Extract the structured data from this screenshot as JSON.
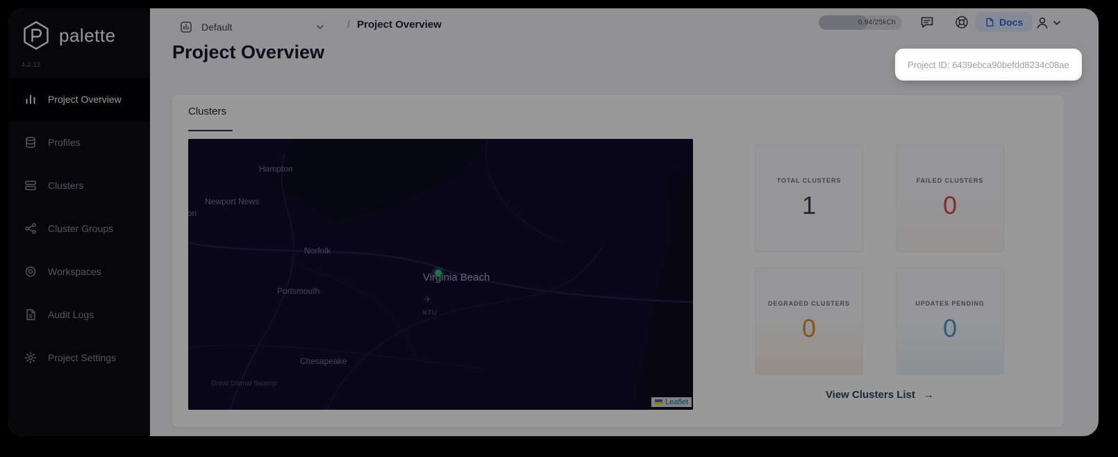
{
  "brand": {
    "name": "palette",
    "version": "4.2.13"
  },
  "sidebar": {
    "items": [
      {
        "label": "Project Overview"
      },
      {
        "label": "Profiles"
      },
      {
        "label": "Clusters"
      },
      {
        "label": "Cluster Groups"
      },
      {
        "label": "Workspaces"
      },
      {
        "label": "Audit Logs"
      },
      {
        "label": "Project Settings"
      }
    ]
  },
  "header": {
    "scope_selector": {
      "value": "Default"
    },
    "breadcrumb": {
      "separator": "/",
      "current": "Project Overview"
    },
    "usage_pill": {
      "text": "0.94/25kCh"
    },
    "docs_button": {
      "label": "Docs"
    }
  },
  "page": {
    "title": "Project Overview",
    "project_id_badge": "Project ID: 6439ebca90befdd8234c08ae"
  },
  "clusters": {
    "section_tab": "Clusters",
    "stats": [
      {
        "label": "TOTAL CLUSTERS",
        "value": "1",
        "color": "#3f3f54"
      },
      {
        "label": "FAILED CLUSTERS",
        "value": "0",
        "color": "#d94f44"
      },
      {
        "label": "DEGRADED CLUSTERS",
        "value": "0",
        "color": "#e08a2e"
      },
      {
        "label": "UPDATES PENDING",
        "value": "0",
        "color": "#4f97d8"
      }
    ],
    "view_list_label": "View Clusters List",
    "view_list_arrow": "→"
  },
  "map": {
    "labels": [
      {
        "text": "Hampton"
      },
      {
        "text": "Newport News"
      },
      {
        "text": "llton"
      },
      {
        "text": "Norfolk"
      },
      {
        "text": "Virginia Beach"
      },
      {
        "text": "Portsmouth"
      },
      {
        "text": "Chesapeake"
      },
      {
        "text": "Great Dismal Swamp"
      }
    ],
    "poi_label": "NTU",
    "plane_glyph": "✈",
    "marker_color": "#35b97e",
    "attribution": "Leaflet"
  }
}
